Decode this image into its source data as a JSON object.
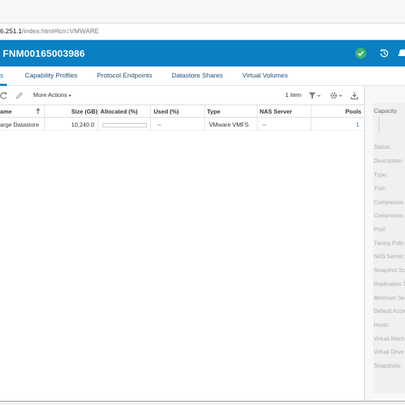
{
  "browser": {
    "url_host": "6.251.1",
    "url_path": "/index.html#lcn=VMWARE"
  },
  "header": {
    "title": "FNM00165003986",
    "status_color": "#3cb371",
    "bar_color": "#0a7fc2"
  },
  "tabs": [
    {
      "label": "s",
      "active": true
    },
    {
      "label": "Capability Profiles"
    },
    {
      "label": "Protocol Endpoints"
    },
    {
      "label": "Datastore Shares"
    },
    {
      "label": "Virtual Volumes"
    }
  ],
  "toolbar": {
    "more_actions_label": "More Actions",
    "item_count": "1 item",
    "icons": [
      "refresh-icon",
      "edit-icon",
      "filter-icon",
      "settings-icon",
      "export-icon"
    ]
  },
  "table": {
    "columns": [
      "ame",
      "Size (GB)",
      "Allocated (%)",
      "Used (%)",
      "Type",
      "NAS Server",
      "Pools"
    ],
    "rows": [
      {
        "name": "arge Datastore",
        "size": "10,240.0",
        "allocated": 0,
        "used": "--",
        "type": "VMware VMFS",
        "nas_server": "--",
        "pools": "1"
      }
    ]
  },
  "details": {
    "capacity_label": "Capacity",
    "fields": [
      "Status:",
      "Description:",
      "Type:",
      "Thin:",
      "Compressio",
      "Compressio",
      "Pool:",
      "Tiering Polic",
      "NAS Server:",
      "Snapshot Sc",
      "Replication T",
      "Minimum Se",
      "Default Acce",
      "Hosts:",
      "Virtual Mach",
      "Virtual Drive",
      "Snapshots:"
    ]
  }
}
